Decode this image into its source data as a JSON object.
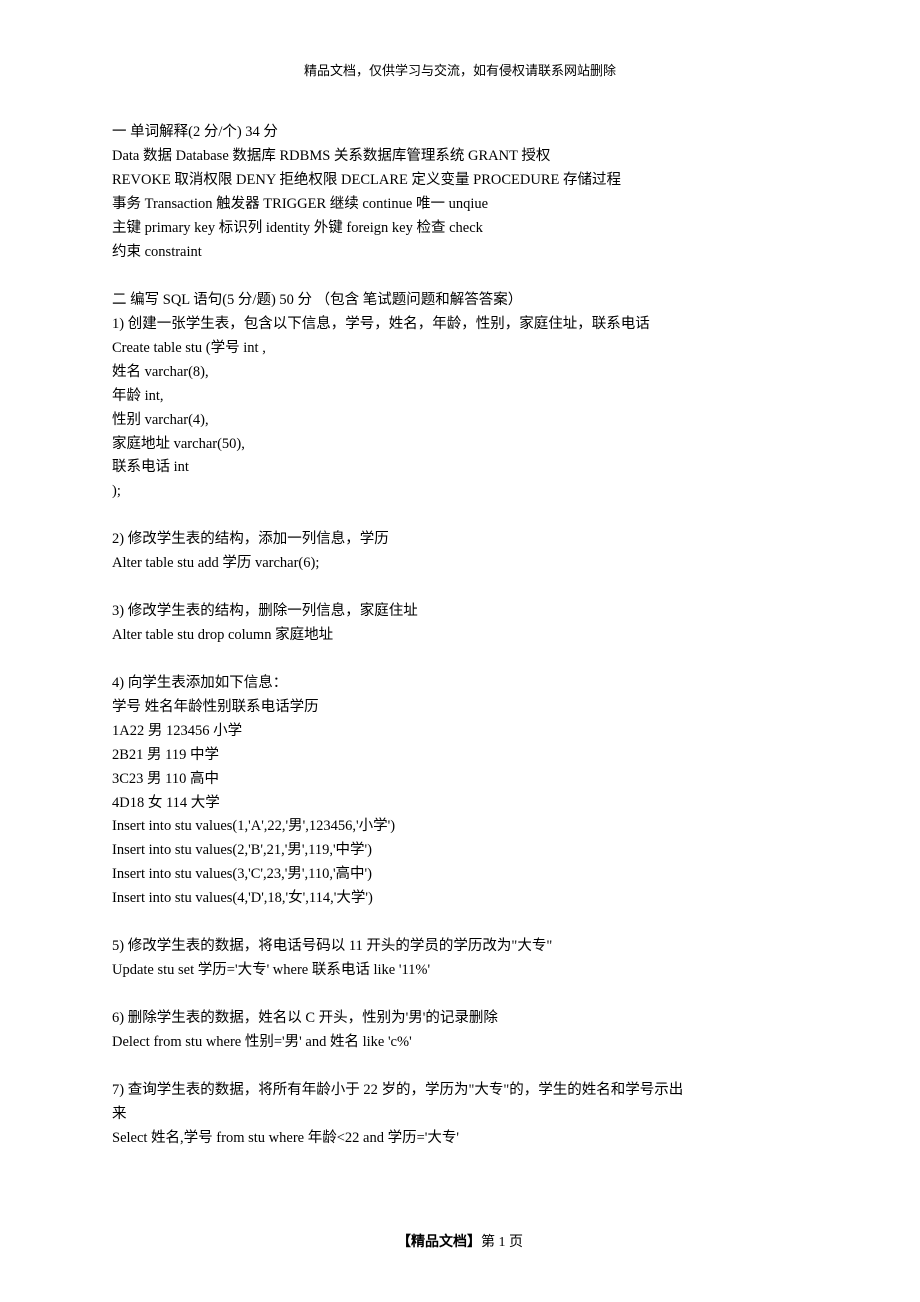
{
  "header": {
    "notice": "精品文档，仅供学习与交流，如有侵权请联系网站删除"
  },
  "section1": {
    "title": "一 单词解释(2 分/个) 34 分",
    "lines": [
      "Data 数据 Database 数据库 RDBMS 关系数据库管理系统 GRANT 授权",
      "REVOKE 取消权限 DENY 拒绝权限 DECLARE 定义变量 PROCEDURE 存储过程",
      "事务 Transaction 触发器 TRIGGER 继续 continue 唯一 unqiue",
      "主键 primary key 标识列 identity 外键 foreign key 检查 check",
      "约束 constraint"
    ]
  },
  "section2": {
    "title": "二 编写 SQL 语句(5 分/题) 50 分 （包含 笔试题问题和解答答案）",
    "q1": {
      "prompt": "1) 创建一张学生表，包含以下信息，学号，姓名，年龄，性别，家庭住址，联系电话",
      "lines": [
        "Create table stu (学号 int ,",
        "姓名 varchar(8),",
        "年龄 int,",
        "性别 varchar(4),",
        "家庭地址 varchar(50),",
        "联系电话 int",
        ");"
      ]
    },
    "q2": {
      "prompt": "2) 修改学生表的结构，添加一列信息，学历",
      "answer": "Alter table stu add 学历 varchar(6);"
    },
    "q3": {
      "prompt": "3) 修改学生表的结构，删除一列信息，家庭住址",
      "answer": "Alter table stu drop column 家庭地址"
    },
    "q4": {
      "prompt": "4) 向学生表添加如下信息：",
      "header": "学号 姓名年龄性别联系电话学历",
      "rows": [
        "1A22 男 123456 小学",
        "2B21 男 119 中学",
        "3C23 男 110 高中",
        "4D18 女 114 大学"
      ],
      "inserts": [
        "Insert into stu values(1,'A',22,'男',123456,'小学')",
        "Insert into stu values(2,'B',21,'男',119,'中学')",
        "Insert into stu values(3,'C',23,'男',110,'高中')",
        "Insert into stu values(4,'D',18,'女',114,'大学')"
      ]
    },
    "q5": {
      "prompt": "5) 修改学生表的数据，将电话号码以 11 开头的学员的学历改为\"大专\"",
      "answer": "Update stu set 学历='大专' where 联系电话 like '11%'"
    },
    "q6": {
      "prompt": "6) 删除学生表的数据，姓名以 C 开头，性别为'男'的记录删除",
      "answer": "Delect from stu where 性别='男' and 姓名 like 'c%'"
    },
    "q7": {
      "prompt1": "7) 查询学生表的数据，将所有年龄小于 22 岁的，学历为\"大专\"的，学生的姓名和学号示出",
      "prompt2": "来",
      "answer": "Select 姓名,学号 from stu where 年龄<22 and 学历='大专'"
    }
  },
  "footer": {
    "prefix": "【精品文档】",
    "page_label": "第 1 页"
  }
}
